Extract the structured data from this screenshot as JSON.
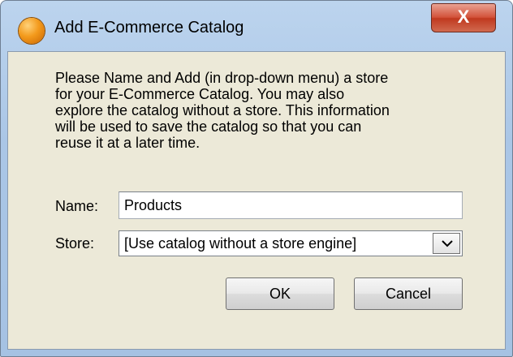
{
  "window": {
    "title": "Add E-Commerce Catalog",
    "icon": "orange-orb-icon",
    "close_glyph": "X"
  },
  "dialog": {
    "message_lines": [
      "Please Name and Add (in drop-down menu) a store",
      "for your E-Commerce Catalog. You may also",
      "explore the catalog without a store. This information",
      "will be used to save the catalog so that you can",
      "reuse it at a later time."
    ],
    "name_label": "Name:",
    "name_value": "Products",
    "store_label": "Store:",
    "store_selected": "[Use catalog without a store engine]",
    "ok_label": "OK",
    "cancel_label": "Cancel"
  },
  "colors": {
    "dialog_background": "#ece9d8",
    "title_bar": "#aac6e6",
    "close_button": "#c9472c"
  }
}
